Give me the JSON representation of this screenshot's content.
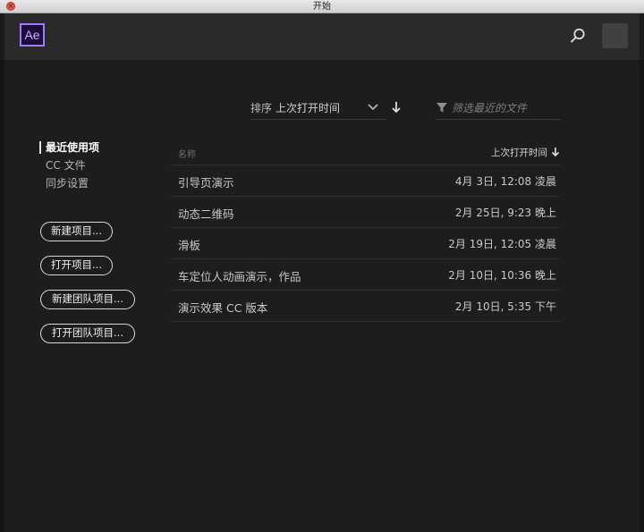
{
  "window": {
    "title": "开始"
  },
  "appbar": {
    "logo_text": "Ae",
    "search_icon": "search-icon",
    "user_icon": "user-avatar-box"
  },
  "sort": {
    "label": "排序",
    "value": "上次打开时间",
    "direction": "descending"
  },
  "filter": {
    "placeholder": "筛选最近的文件"
  },
  "nav": {
    "items": [
      {
        "label": "最近使用项",
        "active": true
      },
      {
        "label": "CC 文件",
        "active": false
      },
      {
        "label": "同步设置",
        "active": false
      }
    ]
  },
  "actions": {
    "new_project": "新建项目...",
    "open_project": "打开项目...",
    "new_team_project": "新建团队项目...",
    "open_team_project": "打开团队项目..."
  },
  "table": {
    "header_name": "名称",
    "header_date": "上次打开时间",
    "rows": [
      {
        "name": "引导页演示",
        "date": "4月 3日, 12:08 凌晨"
      },
      {
        "name": "动态二维码",
        "date": "2月 25日, 9:23 晚上"
      },
      {
        "name": "滑板",
        "date": "2月 19日, 12:05 凌晨"
      },
      {
        "name": "车定位人动画演示，作品",
        "date": "2月 10日, 10:36 晚上"
      },
      {
        "name": "演示效果 CC 版本",
        "date": "2月 10日, 5:35 下午"
      }
    ]
  },
  "colors": {
    "background": "#1d1d1d",
    "appbar": "#2a2a2a",
    "logo_border": "#9a7ef5",
    "logo_fill": "#1f0a3c"
  }
}
